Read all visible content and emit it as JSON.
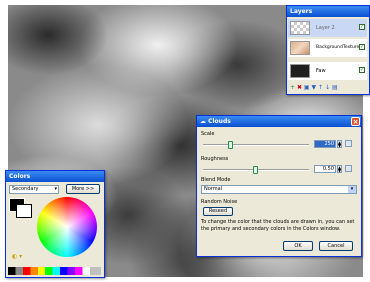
{
  "layers_window": {
    "title": "Layers",
    "layers": [
      {
        "name": "Layer 2",
        "visible": true,
        "selected": true
      },
      {
        "name": "BackgroundTexture",
        "visible": true,
        "selected": false
      },
      {
        "name": "Faw",
        "visible": true,
        "selected": false
      }
    ]
  },
  "colors_window": {
    "title": "Colors",
    "target": "Secondary",
    "more_button": "More >>"
  },
  "clouds_dialog": {
    "title": "Clouds",
    "scale_label": "Scale",
    "scale_value": "250",
    "roughness_label": "Roughness",
    "roughness_value": "0.50",
    "blend_mode_label": "Blend Mode",
    "blend_mode_value": "Normal",
    "random_noise_label": "Random Noise",
    "reseed_button": "Reseed",
    "hint": "To change the color that the clouds are drawn in, you can set the primary and secondary colors in the Colors window.",
    "ok_button": "OK",
    "cancel_button": "Cancel"
  }
}
